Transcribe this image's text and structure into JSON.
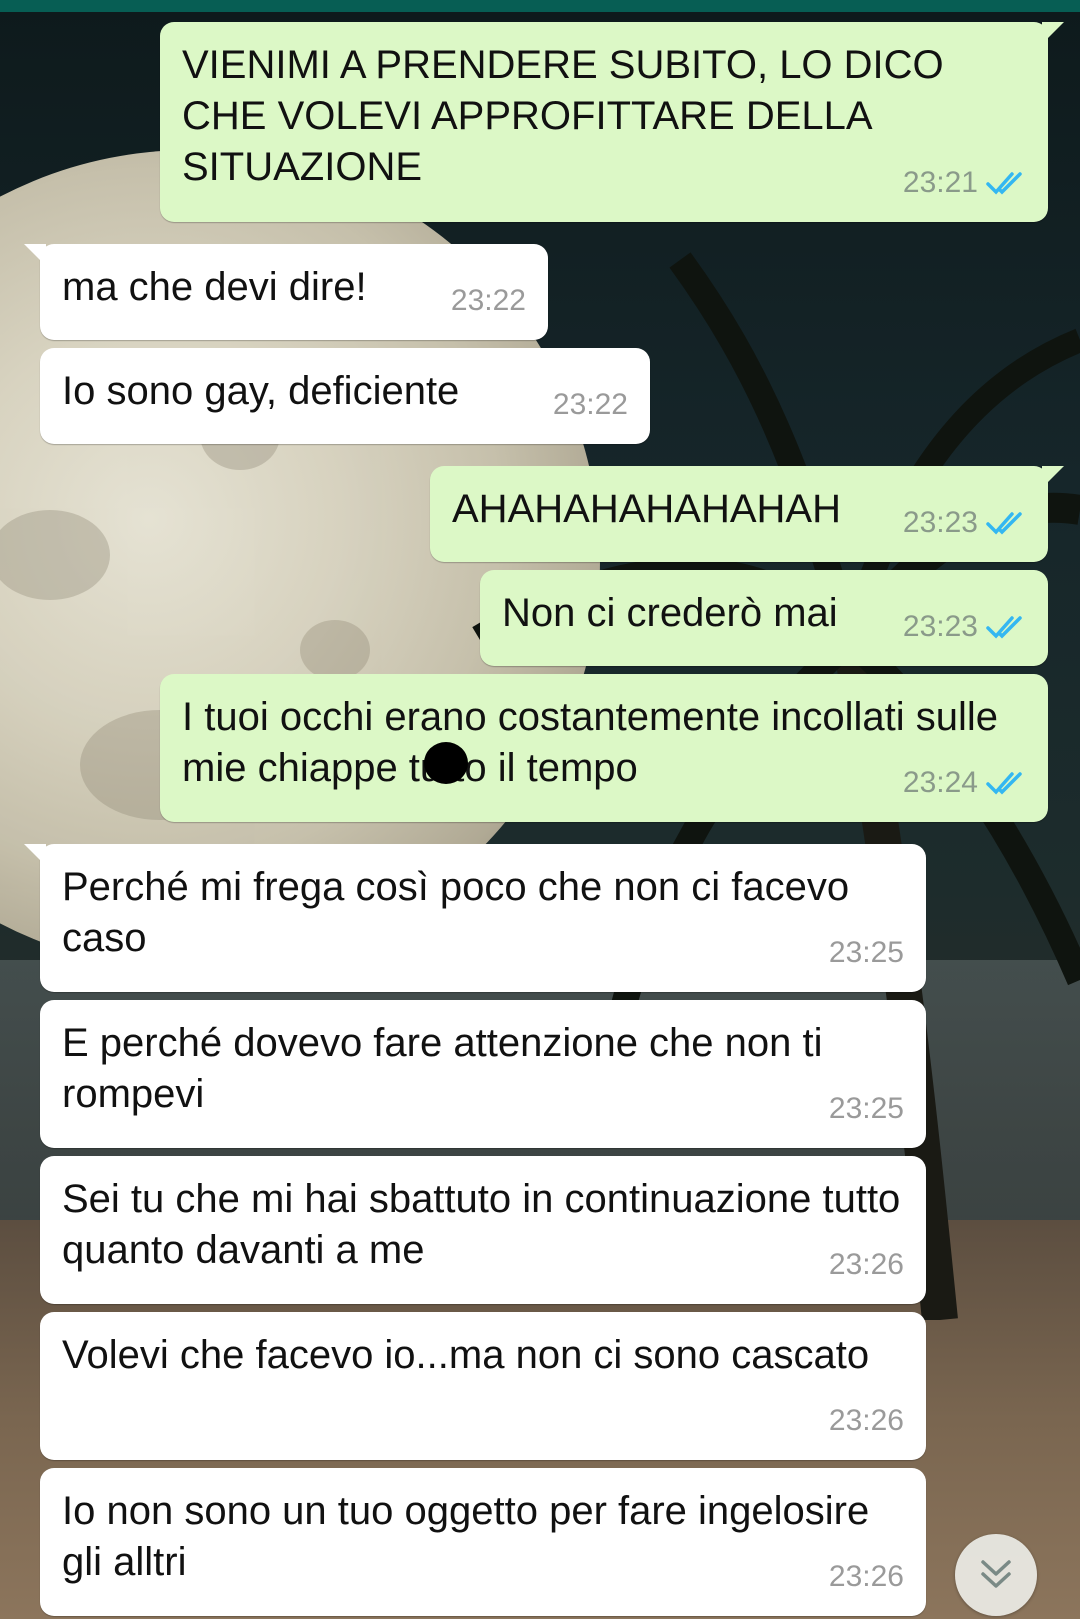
{
  "colors": {
    "outgoing_bubble": "#dcf8c6",
    "incoming_bubble": "#ffffff",
    "read_ticks": "#34b7f1",
    "topbar": "#075e54"
  },
  "messages": [
    {
      "direction": "outgoing",
      "text": "VIENIMI A PRENDERE SUBITO, LO DICO CHE VOLEVI APPROFITTARE DELLA SITUAZIONE",
      "time": "23:21",
      "status_icon": "double-check-read-icon"
    },
    {
      "direction": "incoming",
      "text": "ma che devi dire!",
      "time": "23:22"
    },
    {
      "direction": "incoming",
      "text": "Io sono gay, deficiente",
      "time": "23:22"
    },
    {
      "direction": "outgoing",
      "text": "AHAHAHAHAHAHAH",
      "time": "23:23",
      "status_icon": "double-check-read-icon"
    },
    {
      "direction": "outgoing",
      "text": "Non ci crederò mai",
      "time": "23:23",
      "status_icon": "double-check-read-icon"
    },
    {
      "direction": "outgoing",
      "text": "I tuoi occhi erano costantemente incollati sulle mie chiappe tutto il tempo",
      "time": "23:24",
      "status_icon": "double-check-read-icon"
    },
    {
      "direction": "incoming",
      "text": "Perché mi frega così poco che non ci facevo caso",
      "time": "23:25"
    },
    {
      "direction": "incoming",
      "text": "E perché dovevo fare attenzione che non ti rompevi",
      "time": "23:25"
    },
    {
      "direction": "incoming",
      "text": "Sei tu che mi hai sbattuto in continuazione tutto quanto davanti a me",
      "time": "23:26"
    },
    {
      "direction": "incoming",
      "text": "Volevi che facevo io...ma non ci sono cascato",
      "time": "23:26"
    },
    {
      "direction": "incoming",
      "text": "Io non sono un tuo oggetto per fare ingelosire gli alltri",
      "time": "23:26"
    }
  ],
  "scroll_button": {
    "icon": "double-chevron-down-icon"
  }
}
